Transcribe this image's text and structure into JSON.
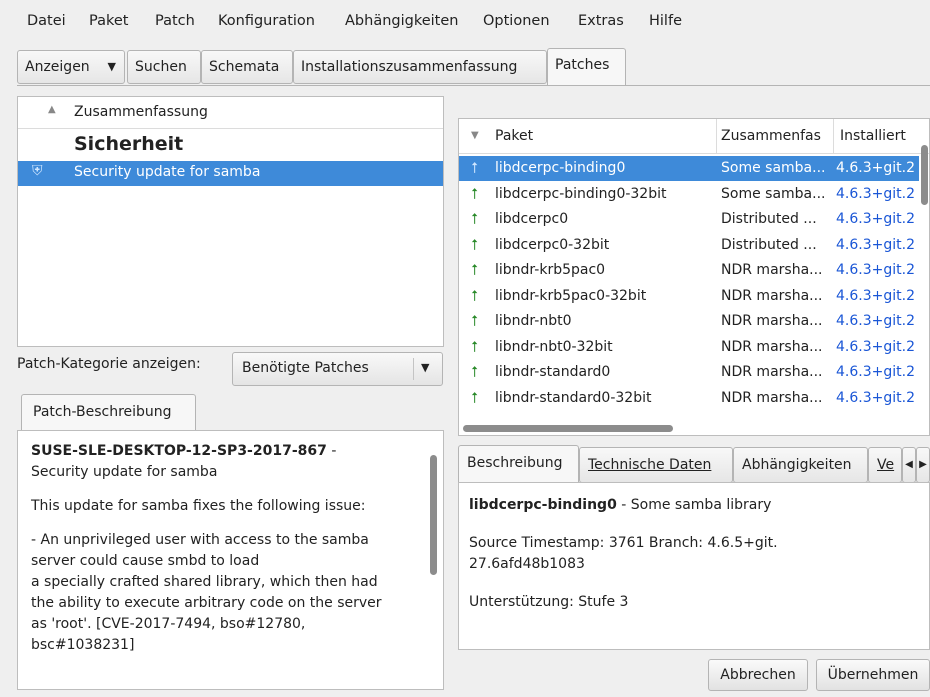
{
  "menu": [
    "Datei",
    "Paket",
    "Patch",
    "Konfiguration",
    "Abhängigkeiten",
    "Optionen",
    "Extras",
    "Hilfe"
  ],
  "tabs": {
    "view": "Anzeigen",
    "search": "Suchen",
    "repos": "Schemata",
    "summary": "Installationszusammenfassung",
    "patches": "Patches"
  },
  "patch_list": {
    "header": "Zusammenfassung",
    "category": "Sicherheit",
    "selected_item": "Security update for samba"
  },
  "category_filter": {
    "label": "Patch-Kategorie anzeigen:",
    "value": "Benötigte Patches"
  },
  "description": {
    "tab": "Patch-Beschreibung",
    "title": "SUSE-SLE-DESKTOP-12-SP3-2017-867",
    "title_sep": " -",
    "subtitle": "Security update for samba",
    "para1": "This update for samba fixes the following issue:",
    "para2_l1": "- An unprivileged user with access to the samba",
    "para2_l2": "server could cause smbd to load",
    "para2_l3": "a specially crafted shared library, which then had",
    "para2_l4": "the ability to execute arbitrary code on the server",
    "para2_l5": "as 'root'. [CVE-2017-7494, bso#12780,",
    "para2_l6": "bsc#1038231]"
  },
  "packages": {
    "columns": [
      "Paket",
      "Zusammenfas",
      "Installiert"
    ],
    "rows": [
      {
        "name": "libdcerpc-binding0",
        "summary": "Some samba...",
        "installed": "4.6.3+git.2"
      },
      {
        "name": "libdcerpc-binding0-32bit",
        "summary": "Some samba...",
        "installed": "4.6.3+git.2"
      },
      {
        "name": "libdcerpc0",
        "summary": "Distributed ...",
        "installed": "4.6.3+git.2"
      },
      {
        "name": "libdcerpc0-32bit",
        "summary": "Distributed ...",
        "installed": "4.6.3+git.2"
      },
      {
        "name": "libndr-krb5pac0",
        "summary": "NDR marsha...",
        "installed": "4.6.3+git.2"
      },
      {
        "name": "libndr-krb5pac0-32bit",
        "summary": "NDR marsha...",
        "installed": "4.6.3+git.2"
      },
      {
        "name": "libndr-nbt0",
        "summary": "NDR marsha...",
        "installed": "4.6.3+git.2"
      },
      {
        "name": "libndr-nbt0-32bit",
        "summary": "NDR marsha...",
        "installed": "4.6.3+git.2"
      },
      {
        "name": "libndr-standard0",
        "summary": "NDR marsha...",
        "installed": "4.6.3+git.2"
      },
      {
        "name": "libndr-standard0-32bit",
        "summary": "NDR marsha...",
        "installed": "4.6.3+git.2"
      }
    ]
  },
  "detail_tabs": [
    "Beschreibung",
    "Technische Daten",
    "Abhängigkeiten",
    "Ve"
  ],
  "detail": {
    "pkg": "libdcerpc-binding0",
    "pkg_desc": " - Some samba library",
    "ts_l1": "Source Timestamp: 3761 Branch: 4.6.5+git.",
    "ts_l2": "27.6afd48b1083",
    "support": "Unterstützung: Stufe 3"
  },
  "buttons": {
    "cancel": "Abbrechen",
    "accept": "Übernehmen"
  },
  "colors": {
    "selection": "#3e8ad9",
    "version_link": "#1a56d6",
    "update_icon": "#2a8a2a"
  }
}
